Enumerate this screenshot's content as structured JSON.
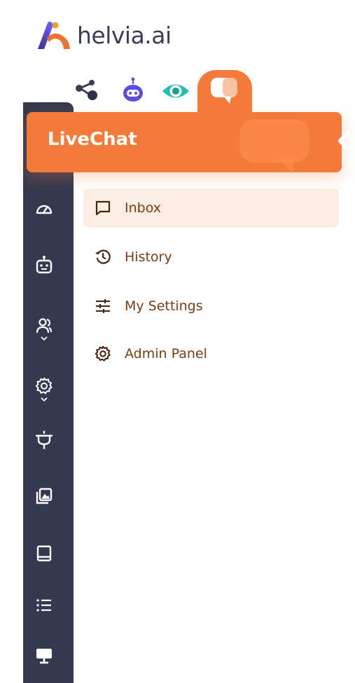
{
  "brand": {
    "name": "helvia.ai",
    "accent_color": "#f47a3a",
    "rail_color": "#35394f",
    "active_item_bg": "#fdeee4",
    "menu_text_color": "#7a3d12"
  },
  "product_switcher": {
    "items": [
      {
        "icon": "graph-nodes-icon",
        "active": false
      },
      {
        "icon": "robot-icon",
        "active": false
      },
      {
        "icon": "eye-icon",
        "active": false
      },
      {
        "icon": "chat-bubble-icon",
        "active": true
      }
    ]
  },
  "header": {
    "title": "LiveChat"
  },
  "menu": {
    "items": [
      {
        "label": "Inbox",
        "icon": "message-square-icon",
        "active": true
      },
      {
        "label": "History",
        "icon": "history-icon",
        "active": false
      },
      {
        "label": "My Settings",
        "icon": "sliders-icon",
        "active": false
      },
      {
        "label": "Admin Panel",
        "icon": "gear-icon",
        "active": false
      }
    ]
  },
  "rail": {
    "items": [
      {
        "icon": "gauge-icon",
        "has_submenu": false
      },
      {
        "icon": "robot-icon",
        "has_submenu": false
      },
      {
        "icon": "users-icon",
        "has_submenu": true
      },
      {
        "icon": "gear-icon",
        "has_submenu": true
      },
      {
        "icon": "plug-icon",
        "has_submenu": false
      },
      {
        "icon": "image-gallery-icon",
        "has_submenu": false
      },
      {
        "icon": "book-icon",
        "has_submenu": false
      },
      {
        "icon": "list-icon",
        "has_submenu": false
      },
      {
        "icon": "monitor-icon",
        "has_submenu": false
      }
    ]
  }
}
